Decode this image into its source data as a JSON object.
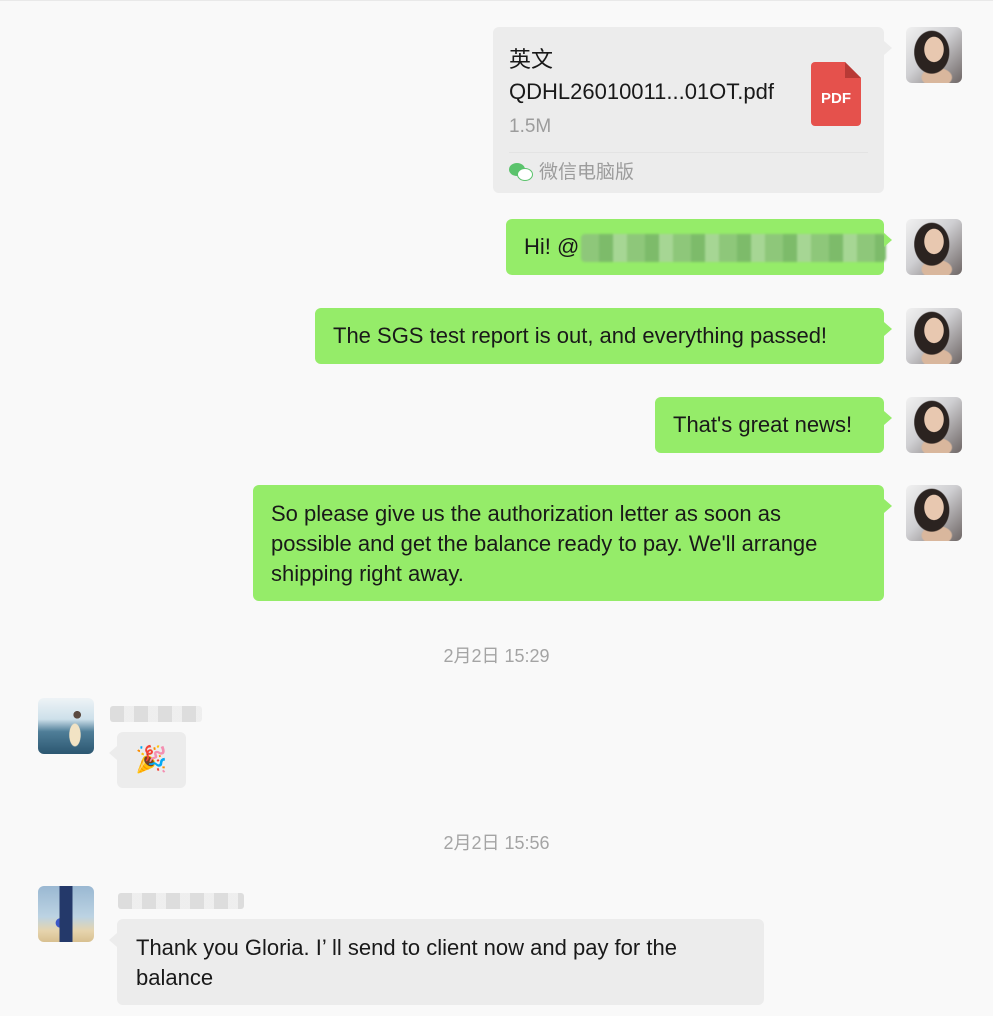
{
  "file_message": {
    "name_line1": "英文",
    "name_line2": "QDHL26010011...01OT.pdf",
    "size": "1.5M",
    "badge": "PDF",
    "source": "微信电脑版",
    "icon": "pdf-file-icon",
    "source_icon": "wechat-icon"
  },
  "messages": [
    {
      "text": "Hi! @"
    },
    {
      "text": "The SGS test report is out, and everything passed!"
    },
    {
      "text": "That's great news!"
    },
    {
      "text": "So please give us the authorization letter as soon as possible and get the balance ready to pay. We'll arrange shipping right away."
    }
  ],
  "timestamps": [
    "2月2日 15:29",
    "2月2日 15:56"
  ],
  "incoming": [
    {
      "emoji": "🎉"
    },
    {
      "text": "Thank you Gloria.  I’ ll send to client now and pay for the balance"
    }
  ],
  "colors": {
    "green_bubble": "#95ec69",
    "gray_bubble": "#ececec",
    "background": "#f9f9f9",
    "pdf_red": "#e5514c"
  }
}
